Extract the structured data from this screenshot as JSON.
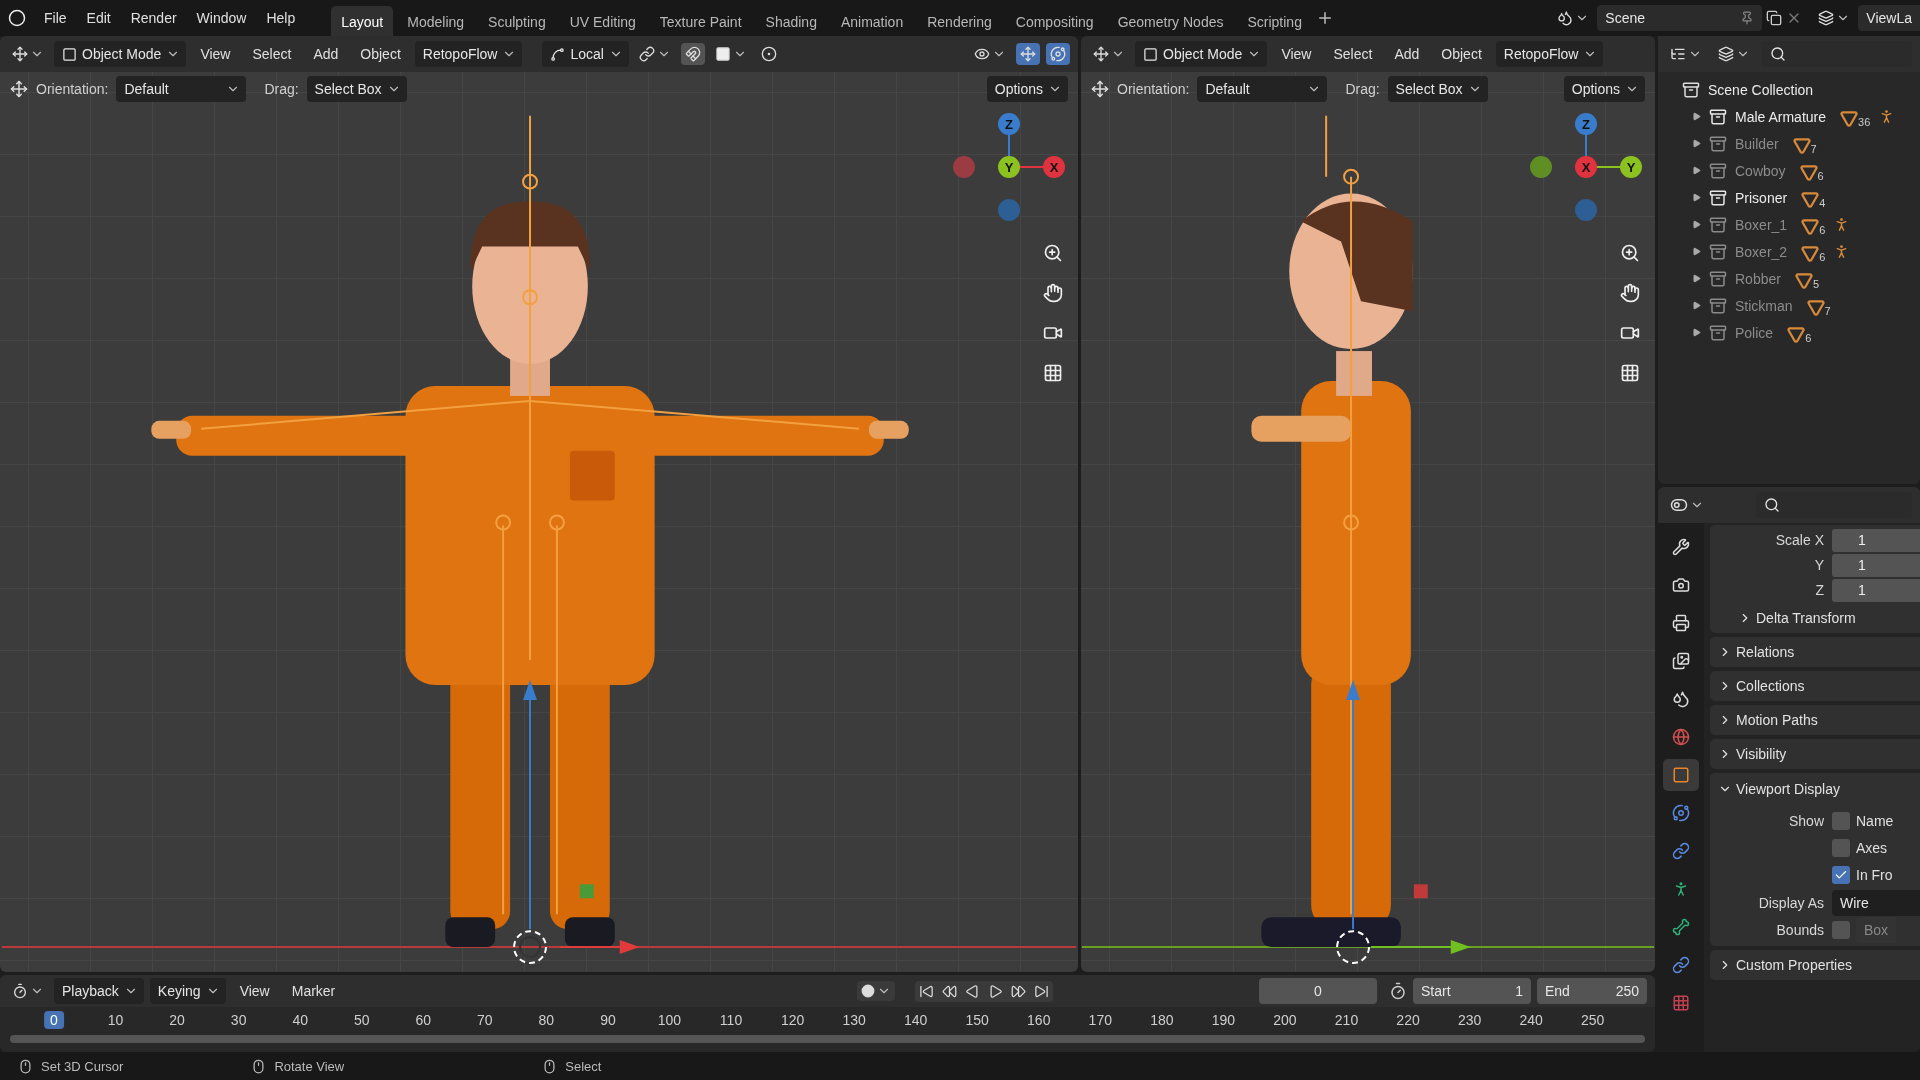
{
  "top_bar": {
    "menus": [
      "File",
      "Edit",
      "Render",
      "Window",
      "Help"
    ],
    "workspaces": [
      {
        "label": "Layout",
        "selected": true
      },
      {
        "label": "Modeling",
        "selected": false
      },
      {
        "label": "Sculpting",
        "selected": false
      },
      {
        "label": "UV Editing",
        "selected": false
      },
      {
        "label": "Texture Paint",
        "selected": false
      },
      {
        "label": "Shading",
        "selected": false
      },
      {
        "label": "Animation",
        "selected": false
      },
      {
        "label": "Rendering",
        "selected": false
      },
      {
        "label": "Compositing",
        "selected": false
      },
      {
        "label": "Geometry Nodes",
        "selected": false
      },
      {
        "label": "Scripting",
        "selected": false
      }
    ],
    "scene": "Scene",
    "view_layer": "ViewLa"
  },
  "viewports": [
    {
      "kind": "front",
      "mode": "Object Mode",
      "menus": [
        "View",
        "Select",
        "Add",
        "Object"
      ],
      "addon": "RetopoFlow",
      "pivot": "Local",
      "orientation_label": "Orientation:",
      "orientation": "Default",
      "drag_label": "Drag:",
      "drag": "Select Box",
      "options": "Options",
      "gizmo": [
        {
          "kind": "top",
          "label": "Z",
          "color": "#3a7ccc"
        },
        {
          "kind": "left",
          "color": "#9b3b42"
        },
        {
          "kind": "right",
          "label": "X",
          "color": "#e0323f"
        },
        {
          "kind": "bottom",
          "color": "#2d5f95"
        },
        {
          "kind": "center",
          "label": "Y",
          "color": "#8cc21f"
        }
      ]
    },
    {
      "kind": "side",
      "mode": "Object Mode",
      "menus": [
        "View",
        "Select",
        "Add",
        "Object"
      ],
      "addon": "RetopoFlow",
      "orientation_label": "Orientation:",
      "orientation": "Default",
      "drag_label": "Drag:",
      "drag": "Select Box",
      "options": "Options",
      "gizmo": [
        {
          "kind": "top",
          "label": "Z",
          "color": "#3a7ccc"
        },
        {
          "kind": "left",
          "color": "#5f8f24"
        },
        {
          "kind": "right",
          "label": "Y",
          "color": "#8cc21f"
        },
        {
          "kind": "bottom",
          "color": "#2d5f95"
        },
        {
          "kind": "center",
          "label": "X",
          "color": "#e0323f"
        }
      ]
    }
  ],
  "outliner": {
    "root": "Scene Collection",
    "items": [
      {
        "name": "Male Armature",
        "count": "36",
        "enabled": true,
        "armature": true
      },
      {
        "name": "Builder",
        "count": "7",
        "enabled": false,
        "armature": false
      },
      {
        "name": "Cowboy",
        "count": "6",
        "enabled": false,
        "armature": false
      },
      {
        "name": "Prisoner",
        "count": "4",
        "enabled": true,
        "armature": false
      },
      {
        "name": "Boxer_1",
        "count": "6",
        "enabled": false,
        "armature": true
      },
      {
        "name": "Boxer_2",
        "count": "6",
        "enabled": false,
        "armature": true
      },
      {
        "name": "Robber",
        "count": "5",
        "enabled": false,
        "armature": false
      },
      {
        "name": "Stickman",
        "count": "7",
        "enabled": false,
        "armature": false
      },
      {
        "name": "Police",
        "count": "6",
        "enabled": false,
        "armature": false
      }
    ]
  },
  "properties": {
    "tabs": [
      {
        "kind": "tool",
        "selected": false
      },
      {
        "kind": "render",
        "selected": false
      },
      {
        "kind": "output",
        "selected": false
      },
      {
        "kind": "view_layer",
        "selected": false
      },
      {
        "kind": "scene",
        "selected": false
      },
      {
        "kind": "world",
        "selected": false
      },
      {
        "kind": "object",
        "selected": true
      },
      {
        "kind": "physics",
        "selected": false
      },
      {
        "kind": "constraints",
        "selected": false
      },
      {
        "kind": "armature",
        "selected": false
      },
      {
        "kind": "bone",
        "selected": false
      },
      {
        "kind": "bone_constraints",
        "selected": false
      },
      {
        "kind": "texture",
        "selected": false
      }
    ],
    "scale": [
      {
        "label": "Scale X",
        "value": "1"
      },
      {
        "label": "Y",
        "value": "1"
      },
      {
        "label": "Z",
        "value": "1"
      }
    ],
    "panels": [
      {
        "kind": "subpanel",
        "title": "Delta Transform",
        "expanded": false
      },
      {
        "kind": "panel",
        "title": "Relations",
        "expanded": false
      },
      {
        "kind": "panel",
        "title": "Collections",
        "expanded": false
      },
      {
        "kind": "panel",
        "title": "Motion Paths",
        "expanded": false
      },
      {
        "kind": "panel",
        "title": "Visibility",
        "expanded": false
      },
      {
        "kind": "panel",
        "title": "Viewport Display",
        "expanded": true
      },
      {
        "kind": "panel",
        "title": "Custom Properties",
        "expanded": false
      }
    ],
    "viewport_display": {
      "show_label": "Show",
      "show": [
        {
          "label": "Name",
          "checked": false
        },
        {
          "label": "Axes",
          "checked": false
        },
        {
          "label": "In Fro",
          "checked": true
        }
      ],
      "display_as_label": "Display As",
      "display_as": "Wire",
      "bounds_label": "Bounds",
      "bounds_checked": false,
      "bounds_type": "Box"
    }
  },
  "timeline": {
    "menus": [
      {
        "label": "Playback",
        "kind": "dropdown"
      },
      {
        "label": "Keying",
        "kind": "dropdown"
      },
      {
        "label": "View",
        "kind": "menu"
      },
      {
        "label": "Marker",
        "kind": "menu"
      }
    ],
    "current_frame": "0",
    "start_label": "Start",
    "start": "1",
    "end_label": "End",
    "end": "250",
    "ruler": [
      {
        "label": "0",
        "selected": true
      },
      {
        "label": "10",
        "selected": false
      },
      {
        "label": "20",
        "selected": false
      },
      {
        "label": "30",
        "selected": false
      },
      {
        "label": "40",
        "selected": false
      },
      {
        "label": "50",
        "selected": false
      },
      {
        "label": "60",
        "selected": false
      },
      {
        "label": "70",
        "selected": false
      },
      {
        "label": "80",
        "selected": false
      },
      {
        "label": "90",
        "selected": false
      },
      {
        "label": "100",
        "selected": false
      },
      {
        "label": "110",
        "selected": false
      },
      {
        "label": "120",
        "selected": false
      },
      {
        "label": "130",
        "selected": false
      },
      {
        "label": "140",
        "selected": false
      },
      {
        "label": "150",
        "selected": false
      },
      {
        "label": "160",
        "selected": false
      },
      {
        "label": "170",
        "selected": false
      },
      {
        "label": "180",
        "selected": false
      },
      {
        "label": "190",
        "selected": false
      },
      {
        "label": "200",
        "selected": false
      },
      {
        "label": "210",
        "selected": false
      },
      {
        "label": "220",
        "selected": false
      },
      {
        "label": "230",
        "selected": false
      },
      {
        "label": "240",
        "selected": false
      },
      {
        "label": "250",
        "selected": false
      }
    ]
  },
  "status_bar": [
    {
      "label": "Set 3D Cursor"
    },
    {
      "label": "Rotate View"
    },
    {
      "label": "Select"
    }
  ]
}
